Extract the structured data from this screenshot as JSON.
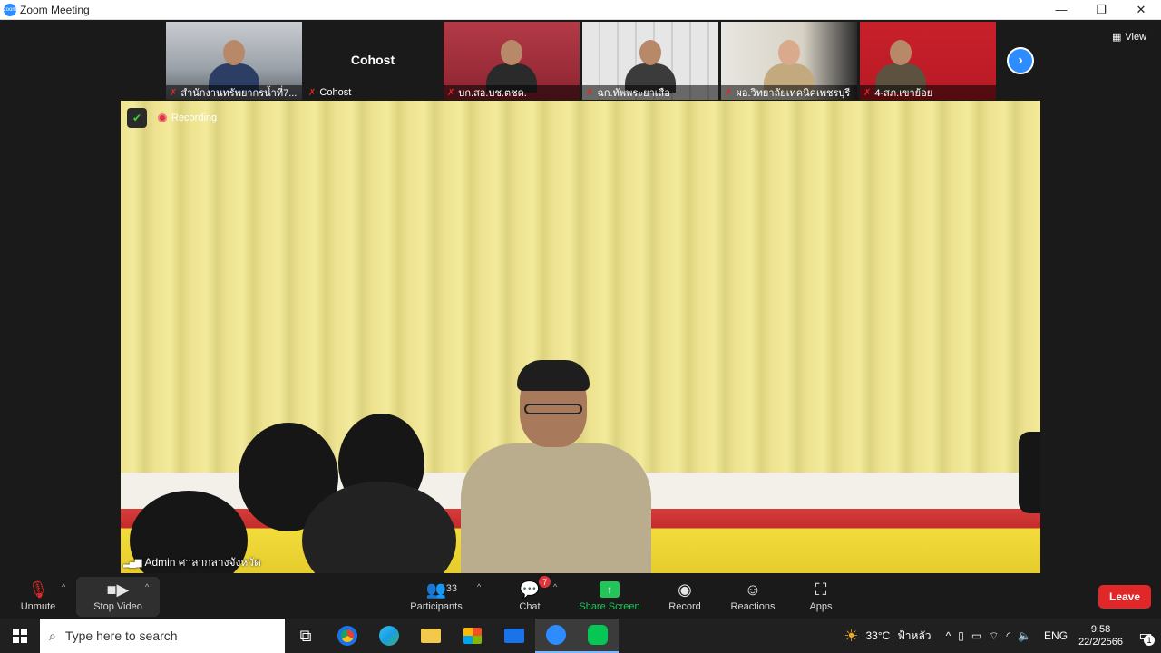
{
  "window": {
    "title": "Zoom Meeting",
    "minimize": "—",
    "restore": "❐",
    "close": "✕"
  },
  "gallery": {
    "tiles": [
      {
        "name": "สำนักงานทรัพยากรน้ำที่7..."
      },
      {
        "name": "Cohost",
        "display_name": "Cohost"
      },
      {
        "name": "บก.สอ.บช.ตชด."
      },
      {
        "name": "ฉก.ทัพพระยาเสือ"
      },
      {
        "name": "ผอ.วิทยาลัยเทคนิคเพชรบุรี"
      },
      {
        "name": "4-สภ.เขาย้อย"
      }
    ],
    "next_arrow": "›",
    "view_label": "View"
  },
  "main_video": {
    "recording_label": "Recording",
    "speaker_name": "Admin ศาลากลางจังหวัด"
  },
  "toolbar": {
    "unmute_label": "Unmute",
    "stop_video_label": "Stop Video",
    "participants_label": "Participants",
    "participants_count": "33",
    "chat_label": "Chat",
    "chat_badge": "7",
    "share_label": "Share Screen",
    "record_label": "Record",
    "reactions_label": "Reactions",
    "apps_label": "Apps",
    "leave_label": "Leave"
  },
  "taskbar": {
    "search_placeholder": "Type here to search",
    "weather_temp": "33°C",
    "weather_text": "ฟ้าหลัว",
    "language": "ENG",
    "time": "9:58",
    "date": "22/2/2566",
    "notification_count": "1"
  },
  "colors": {
    "zoom_blue": "#2d8cff",
    "leave_red": "#e02828",
    "share_green": "#24c45a"
  }
}
